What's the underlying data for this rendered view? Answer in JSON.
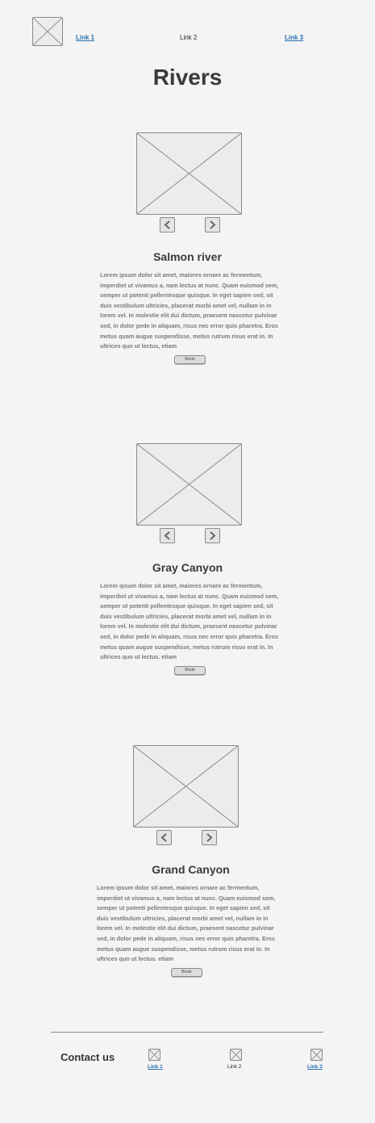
{
  "header": {
    "nav": [
      "Link 1",
      "Link 2",
      "Link 3"
    ]
  },
  "page_title": "Rivers",
  "sections": [
    {
      "title": "Salmon river",
      "text": "Lorem ipsum dolor sit amet, maiores ornare ac fermentum, imperdiet ut vivamus a, nam lectus at nunc. Quam euismod sem, semper ut potenti pellentesque quisque. In eget sapien sed, sit duis vestibulum ultricies, placerat morbi amet vel, nullam in in lorem vel. In molestie elit dui dictum, praesent nascetur pulvinar sed, in dolor pede in aliquam, risus nec error quis pharetra. Eros metus quam augue suspendisse, metus rutrum risus erat in.  In ultrices quo ut lectus, etiam",
      "button": "Book"
    },
    {
      "title": "Gray Canyon",
      "text": "Lorem ipsum dolor sit amet, maiores ornare ac fermentum, imperdiet ut vivamus a, nam lectus at nunc. Quam euismod sem, semper ut potenti pellentesque quisque. In eget sapien sed, sit duis vestibulum ultricies, placerat morbi amet vel, nullam in in lorem vel. In molestie elit dui dictum, praesent nascetur pulvinar sed, in dolor pede in aliquam, risus nec error quis pharetra. Eros metus quam augue suspendisse, metus rutrum risus erat in.  In ultrices quo ut lectus. etiam",
      "button": "Book"
    },
    {
      "title": "Grand Canyon",
      "text": "Lorem ipsum dolor sit amet, maiores ornare ac fermentum, imperdiet ut vivamus a, nam lectus at nunc. Quam euismod sem, semper ut potenti pellentesque quisque. In eget sapien sed, sit duis vestibulum ultricies, placerat morbi amet vel, nullam in in lorem vel. In molestie elit dui dictum, praesent nascetur pulvinar sed, in dolor pede in aliquam, risus nec error quis pharetra. Eros metus quam augue suspendisse, metus rutrum risus erat in.  In ultrices quo ut lectus. etiam",
      "button": "Book"
    }
  ],
  "footer": {
    "contact": "Contact us",
    "links": [
      "Link 1",
      "Link 2",
      "Link 3"
    ]
  },
  "icons": {
    "placeholder": "image-placeholder-icon",
    "prev": "chevron-left-icon",
    "next": "chevron-right-icon"
  },
  "colors": {
    "background": "#f4f4f4",
    "link": "#2a6fb0",
    "placeholder_border": "#8a8a8a",
    "placeholder_fill": "#ececec"
  }
}
